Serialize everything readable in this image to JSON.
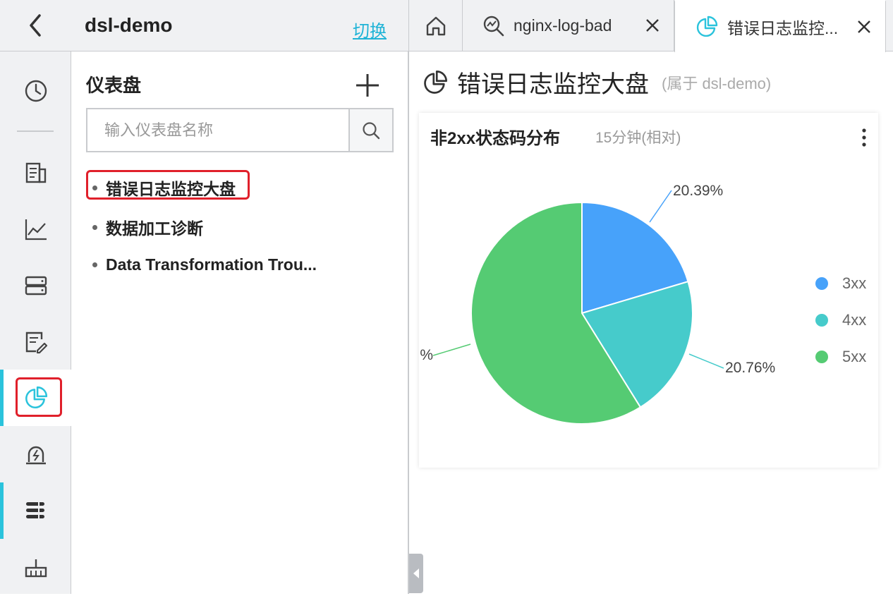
{
  "header": {
    "project_name": "dsl-demo",
    "switch_label": "切换"
  },
  "tabs": [
    {
      "label": "nginx-log-bad",
      "icon": "search-analysis-icon"
    },
    {
      "label": "错误日志监控...",
      "icon": "pie-chart-icon"
    }
  ],
  "sidebar": {
    "title": "仪表盘",
    "search_placeholder": "输入仪表盘名称",
    "dashboards": [
      {
        "label": "错误日志监控大盘"
      },
      {
        "label": "数据加工诊断"
      },
      {
        "label": "Data Transformation Trou..."
      }
    ]
  },
  "main": {
    "title": "错误日志监控大盘",
    "owner": "(属于 dsl-demo)"
  },
  "chart_card": {
    "title": "非2xx状态码分布",
    "time_range": "15分钟(相对)"
  },
  "chart_data": {
    "type": "pie",
    "title": "非2xx状态码分布",
    "categories": [
      "3xx",
      "4xx",
      "5xx"
    ],
    "values": [
      20.39,
      20.76,
      58.85
    ],
    "labels": [
      "20.39%",
      "20.76%",
      "%"
    ],
    "colors": [
      "#47a2fa",
      "#46cbcb",
      "#55cb73"
    ],
    "legend_position": "right"
  },
  "colors": {
    "accent": "#2bc3dc",
    "link": "#1fb3d6",
    "highlight_box": "#e0202b"
  }
}
